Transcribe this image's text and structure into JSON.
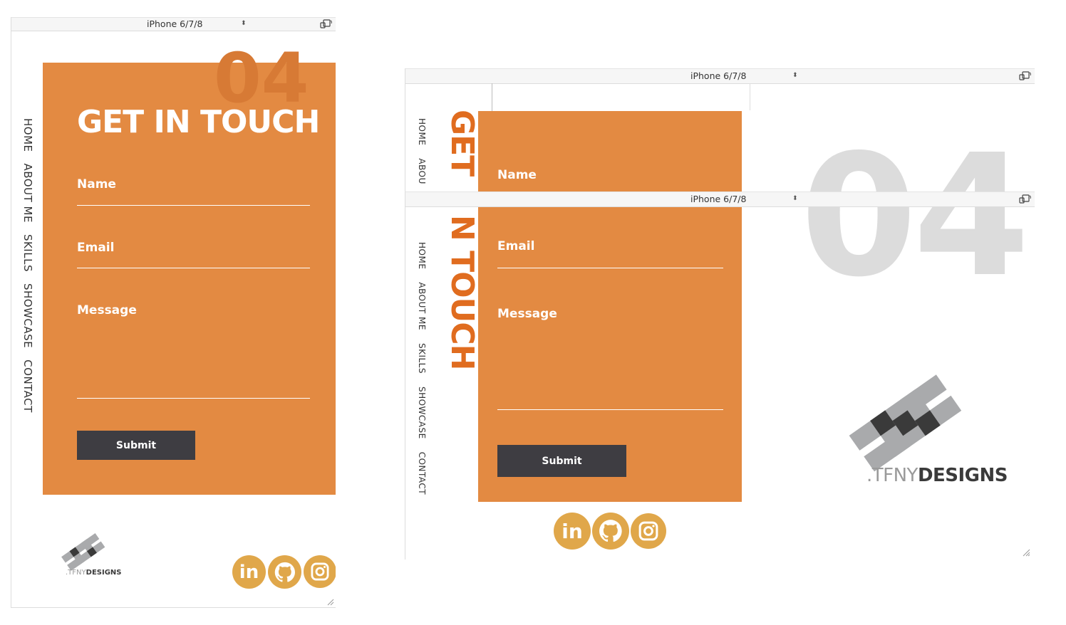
{
  "device_label": "iPhone 6/7/8",
  "nav": [
    "HOME",
    "ABOUT ME",
    "SKILLS",
    "SHOWCASE",
    "CONTACT"
  ],
  "nav_truncated": [
    "HOME",
    "ABOU"
  ],
  "section_number": "04",
  "contact": {
    "title": "GET IN TOUCH",
    "title_top_fragment": "GET",
    "title_bottom_fragment": "N TOUCH",
    "name_label": "Name",
    "email_label": "Email",
    "message_label": "Message",
    "submit_label": "Submit"
  },
  "brand": {
    "prefix": ".TFNY",
    "suffix": "DESIGNS"
  },
  "social": {
    "linkedin": "in"
  },
  "icons": {
    "linkedin": "linkedin-icon",
    "github": "github-icon",
    "instagram": "instagram-icon",
    "rotate": "rotate-device-icon",
    "resize": "resize-handle-icon",
    "logo": "tfny-logo-icon"
  },
  "colors": {
    "accent": "#e38a42",
    "button": "#3e3d42",
    "social": "#e0a74a",
    "watermark_light": "#dcdcdc"
  }
}
